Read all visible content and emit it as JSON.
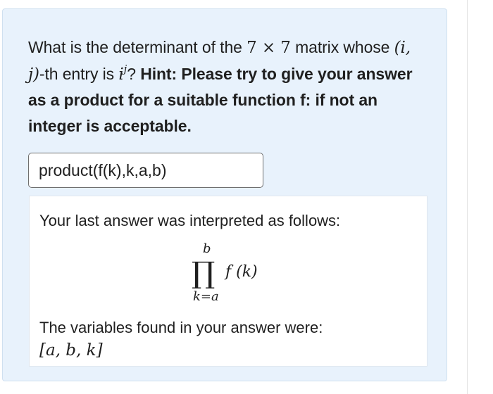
{
  "question": {
    "lead": "What is the determinant of the ",
    "matrix_size_expr": "7 × 7",
    "mid": " matrix whose ",
    "entry_index_expr": "(i, j)",
    "after_entry": "-th entry is ",
    "entry_base": "i",
    "entry_exponent": "j",
    "after_power": "? ",
    "hint": "Hint: Please try to give your answer as a product for a suitable function f: if not an integer is acceptable."
  },
  "answer_input": {
    "value": "product(f(k),k,a,b)"
  },
  "preview": {
    "heading": "Your last answer was interpreted as follows:",
    "product_upper": "b",
    "product_symbol": "∏",
    "product_lower": "k=a",
    "product_term": "f (k)",
    "variables_heading": "The variables found in your answer were:",
    "variables_list": "[a, b, k]"
  }
}
